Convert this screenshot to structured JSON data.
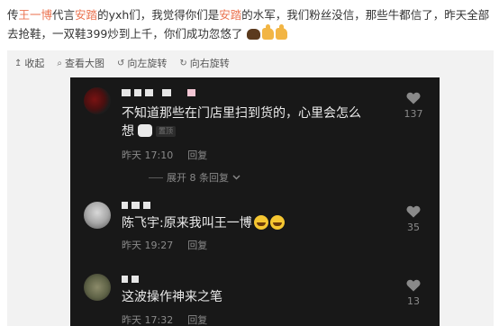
{
  "post": {
    "segments": [
      {
        "text": "传",
        "hl": false
      },
      {
        "text": "王一博",
        "hl": true
      },
      {
        "text": "代言",
        "hl": false
      },
      {
        "text": "安踏",
        "hl": true
      },
      {
        "text": "的yxh们，我觉得你们是",
        "hl": false
      },
      {
        "text": "安踏",
        "hl": true
      },
      {
        "text": "的水军，我们粉丝没信，那些牛都信了，昨天全部去抢鞋，一双鞋399炒到上千，你们成功忽悠了",
        "hl": false
      }
    ],
    "emojis": [
      "bear-emoji",
      "thumb-emoji",
      "thumb-emoji"
    ],
    "colors": {
      "highlight": "#eb7350",
      "text": "#333333"
    }
  },
  "toolbar": {
    "collapse": {
      "icon": "↥",
      "label": "收起"
    },
    "view_large": {
      "icon": "⌕",
      "label": "查看大图"
    },
    "rotate_left": {
      "icon": "↺",
      "label": "向左旋转"
    },
    "rotate_right": {
      "icon": "↻",
      "label": "向右旋转"
    }
  },
  "comments": [
    {
      "text_line1": "不知道那些在门店里扫到货的，心里会怎么",
      "text_line2": "想",
      "badge": "置顶",
      "time": "昨天 17:10",
      "reply": "回复",
      "likes": "137"
    },
    {
      "text": "陈飞宇:原来我叫王一博",
      "time": "昨天 19:27",
      "reply": "回复",
      "likes": "35"
    },
    {
      "text": "这波操作神来之笔",
      "time": "昨天 17:32",
      "reply": "回复",
      "likes": "13"
    }
  ],
  "expand": {
    "label": "展开 8 条回复",
    "icon": "chevron-down-icon"
  }
}
